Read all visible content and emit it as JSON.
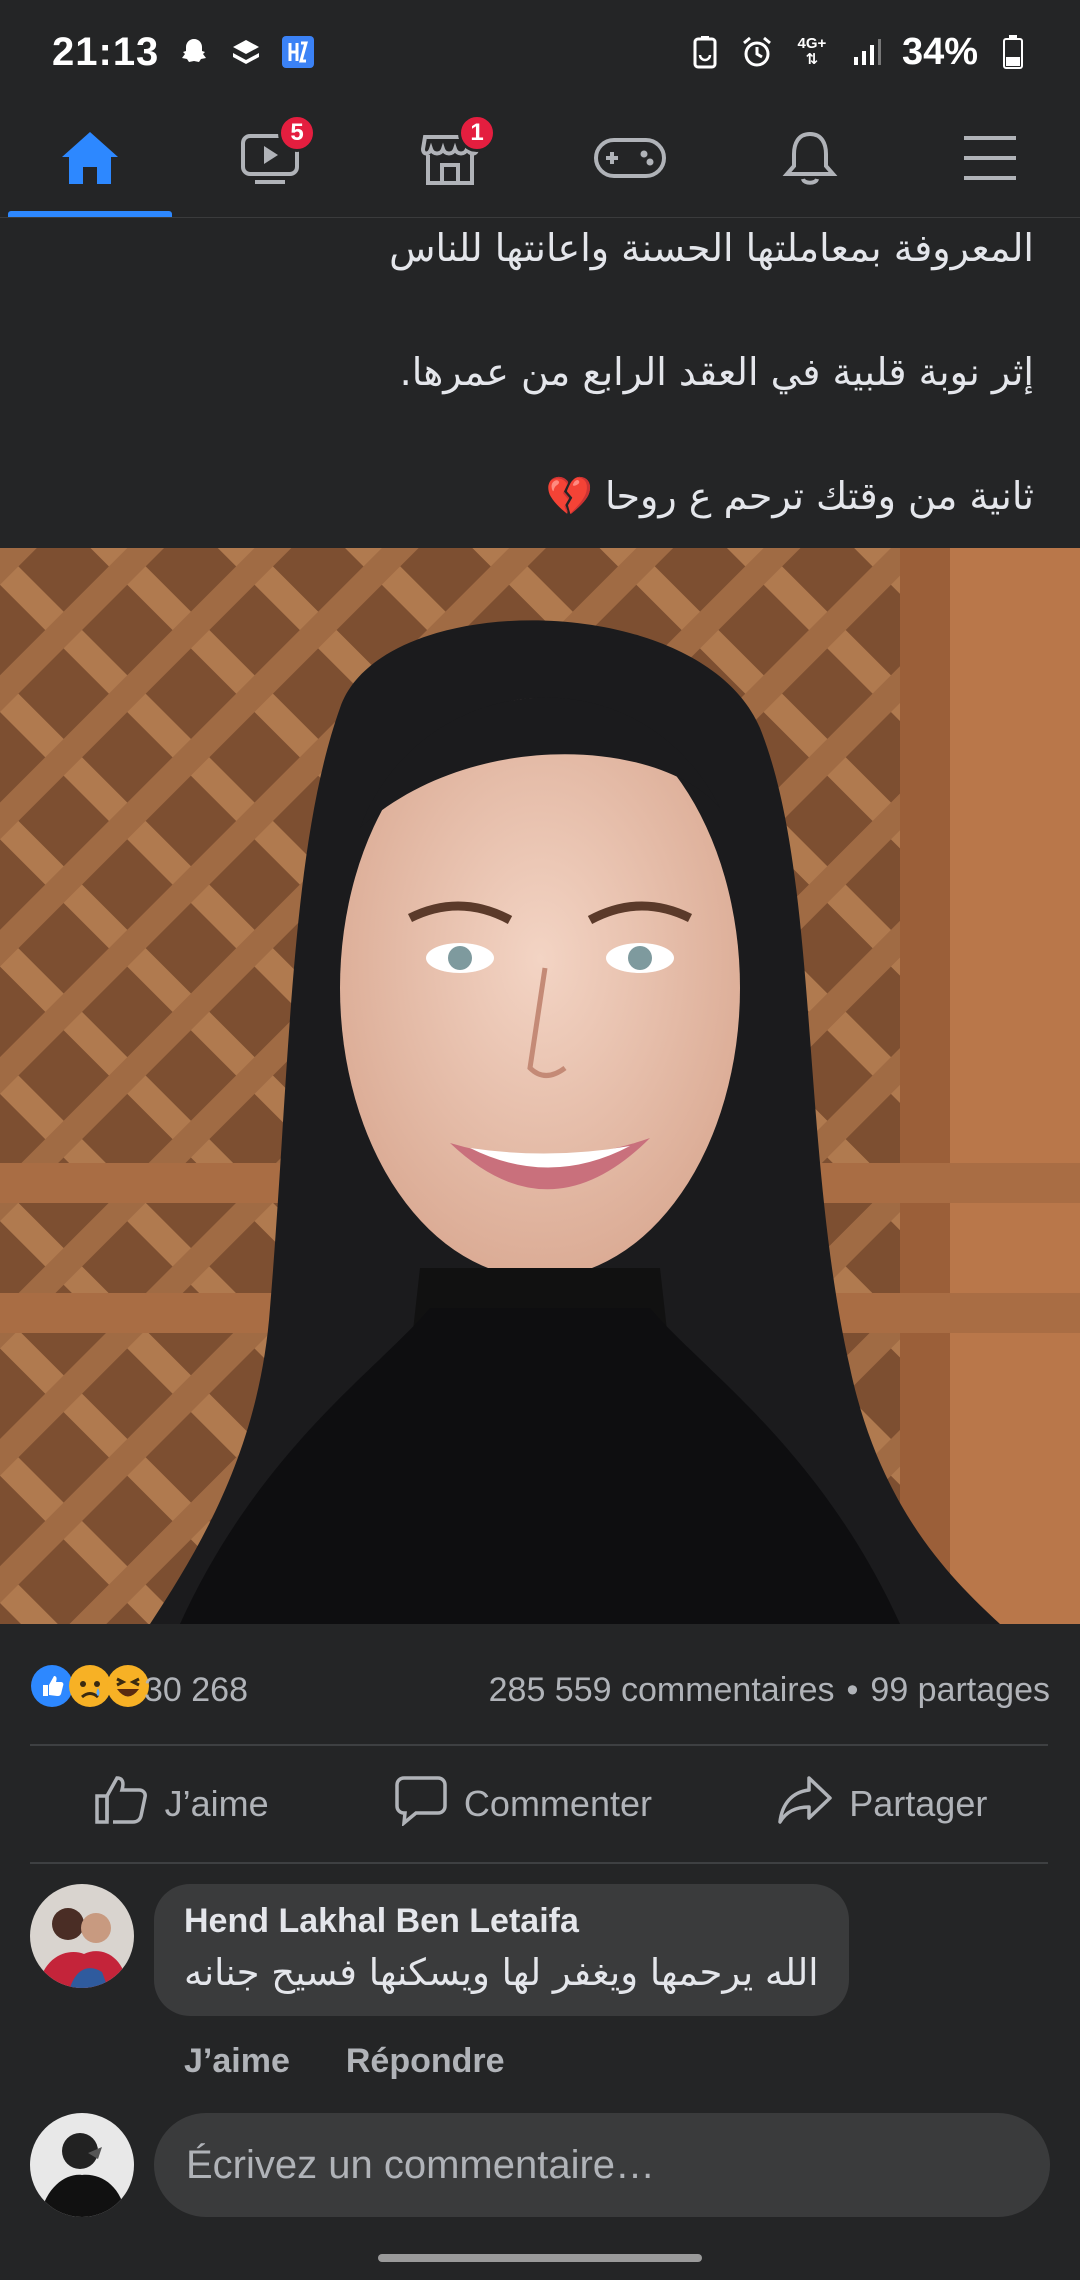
{
  "status_bar": {
    "time": "21:13",
    "left_icons": [
      "snapchat-icon",
      "layers-icon",
      "app-icon"
    ],
    "right_icons": [
      "battery-saver-icon",
      "alarm-icon",
      "4g-icon",
      "signal-icon"
    ],
    "network": "4G+",
    "battery": "34%"
  },
  "nav": {
    "tabs": [
      {
        "name": "home",
        "icon": "home-icon",
        "active": true
      },
      {
        "name": "watch",
        "icon": "video-icon",
        "badge": "5"
      },
      {
        "name": "marketplace",
        "icon": "shop-icon",
        "badge": "1"
      },
      {
        "name": "gaming",
        "icon": "gamepad-icon"
      },
      {
        "name": "notifications",
        "icon": "bell-icon"
      },
      {
        "name": "menu",
        "icon": "menu-icon"
      }
    ]
  },
  "post": {
    "lines": [
      "المعروفة بمعاملتها الحسنة واعانتها للناس",
      "إثر نوبة قلبية في العقد الرابع من عمرها.",
      "ثانية من وقتك ترحم ع روحا"
    ],
    "emoji": "💔"
  },
  "stats": {
    "reaction_count": "30 268",
    "comments": "285 559 commentaires",
    "separator": "•",
    "shares": "99 partages"
  },
  "actions": {
    "like": "J’aime",
    "comment": "Commenter",
    "share": "Partager"
  },
  "comment": {
    "author": "Hend Lakhal Ben Letaifa",
    "text": "الله يرحمها ويغفر لها ويسكنها فسيح جنانه",
    "like": "J’aime",
    "reply": "Répondre"
  },
  "compose": {
    "placeholder": "Écrivez un commentaire…"
  },
  "colors": {
    "background": "#242526",
    "accent": "#2d88ff",
    "badge": "#e41e3f",
    "bubble": "#3a3b3c"
  }
}
